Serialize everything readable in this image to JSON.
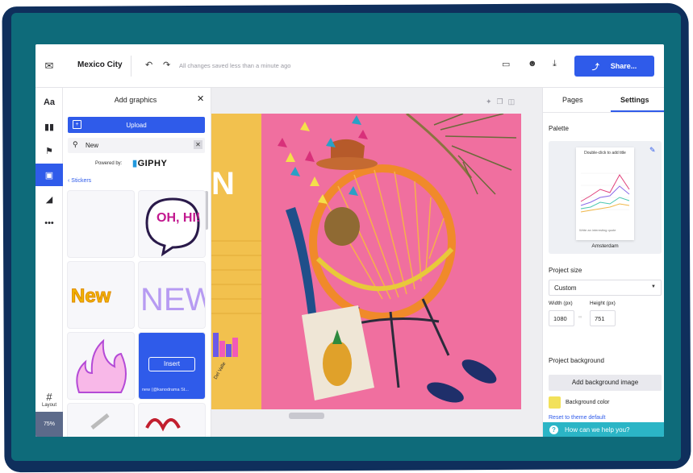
{
  "topbar": {
    "doc_title": "Mexico City",
    "saved_status": "All changes saved less than a minute ago",
    "share_label": "Share..."
  },
  "rail": {
    "text_label": "Aa",
    "layout_label": "Layout",
    "zoom": "75%"
  },
  "graphics_panel": {
    "title": "Add graphics",
    "upload_label": "Upload",
    "search_value": "New",
    "powered_by": "Powered by:",
    "giphy": "GIPHY",
    "section": "Stickers",
    "stickers": [
      {
        "text": ""
      },
      {
        "text": "OH, HI!"
      },
      {
        "text": "New"
      },
      {
        "text": "NEW"
      },
      {
        "text": ""
      },
      {
        "text": "",
        "insert_label": "Insert",
        "caption": "new (@kanodrama St..."
      }
    ]
  },
  "canvas": {
    "heading_fragment": "N",
    "bar_label": "Del Valle"
  },
  "settings_panel": {
    "tabs": [
      "Pages",
      "Settings"
    ],
    "active_tab": "Settings",
    "palette_label": "Palette",
    "palette_preview_title": "Double-click to add title",
    "palette_preview_footer": "Write an interesting quote",
    "palette_name": "Amsterdam",
    "project_size_label": "Project size",
    "size_option": "Custom",
    "width_label": "Width (px)",
    "height_label": "Height (px)",
    "width_value": "1080",
    "height_value": "751",
    "project_bg_label": "Project background",
    "add_bg_image": "Add background image",
    "bg_color_label": "Background color",
    "reset_label": "Reset to theme default",
    "help_label": "How can we help you?"
  },
  "colors": {
    "accent": "#2f5bea",
    "canvas_yellow": "#f2c14e",
    "photo_pink": "#f06f9f",
    "help_teal": "#2bb5c6"
  }
}
